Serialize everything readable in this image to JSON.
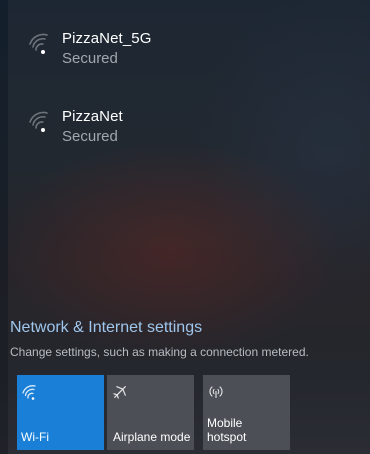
{
  "networks": [
    {
      "name": "PizzaNet_5G",
      "status": "Secured",
      "icon": "wifi-signal-icon"
    },
    {
      "name": "PizzaNet",
      "status": "Secured",
      "icon": "wifi-signal-icon"
    }
  ],
  "settings": {
    "link": "Network & Internet settings",
    "description": "Change settings, such as making a connection metered."
  },
  "quick_actions": [
    {
      "label": "Wi-Fi",
      "icon": "wifi-icon",
      "active": true
    },
    {
      "label": "Airplane mode",
      "icon": "airplane-icon",
      "active": false
    },
    {
      "label_line1": "Mobile",
      "label_line2": "hotspot",
      "icon": "hotspot-icon",
      "active": false
    }
  ],
  "colors": {
    "accent": "#1a7fd6",
    "tile_inactive": "#4c5056",
    "link": "#9fc6ec"
  }
}
